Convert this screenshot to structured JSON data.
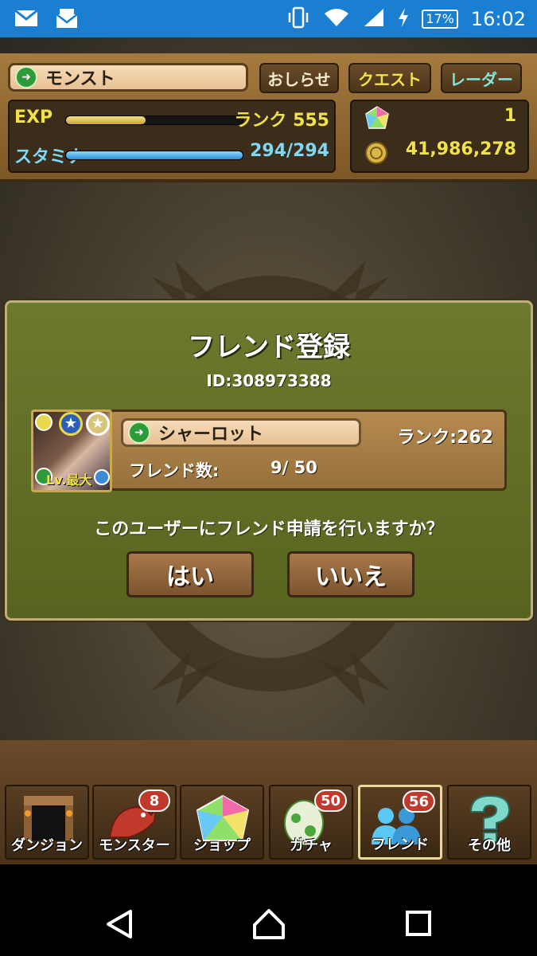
{
  "status_bar": {
    "time": "16:02",
    "battery": "17%",
    "icons": [
      "mail-icon",
      "message-icon",
      "vibrate-icon",
      "wifi-icon",
      "signal-icon",
      "charging-icon"
    ]
  },
  "top_bar": {
    "player_name": "モンスト",
    "buttons": [
      "おしらせ",
      "クエスト",
      "レーダー"
    ],
    "exp_label": "EXP",
    "rank_label": "ランク 555",
    "exp_progress": 0.45,
    "stamina_label": "スタミナ",
    "stamina_value": "294/294",
    "stamina_progress": 1.0,
    "gems": "1",
    "coins": "41,986,278"
  },
  "dialog": {
    "title": "フレンド登録",
    "id": "ID:308973388",
    "avatar_level": "Lv.最大",
    "user_name": "シャーロット",
    "rank": "ランク:262",
    "friend_label": "フレンド数:",
    "friend_count": "9/  50",
    "question": "このユーザーにフレンド申請を行いますか？",
    "yes": "はい",
    "no": "いいえ"
  },
  "bottom_nav": [
    {
      "label": "ダンジョン",
      "badge": ""
    },
    {
      "label": "モンスター",
      "badge": "8"
    },
    {
      "label": "ショップ",
      "badge": ""
    },
    {
      "label": "ガチャ",
      "badge": "50"
    },
    {
      "label": "フレンド",
      "badge": "56"
    },
    {
      "label": "その他",
      "badge": ""
    }
  ],
  "colors": {
    "status_bar": "#1a7fd0",
    "dialog_green": "#6c7a2f",
    "exp_bar": "#e3c35a",
    "stamina_bar": "#37a7e6",
    "yellow_text": "#f2e24a",
    "cyan_text": "#7fd8f4"
  }
}
